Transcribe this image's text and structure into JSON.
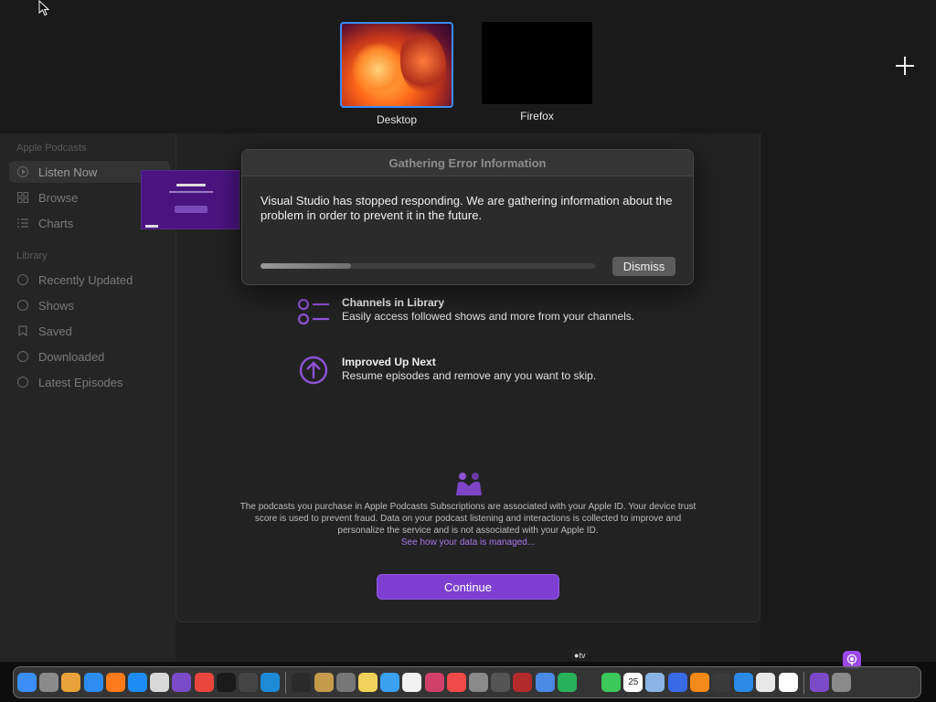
{
  "spaces": {
    "items": [
      {
        "label": "Desktop"
      },
      {
        "label": "Firefox"
      }
    ],
    "add_icon": "plus-icon"
  },
  "sidebar": {
    "section_apple": "Apple Podcasts",
    "section_library": "Library",
    "items": [
      {
        "label": "Listen Now",
        "icon": "play-circle-icon"
      },
      {
        "label": "Browse",
        "icon": "grid-icon"
      },
      {
        "label": "Charts",
        "icon": "list-icon"
      },
      {
        "label": "Recently Updated",
        "icon": "clock-icon"
      },
      {
        "label": "Shows",
        "icon": "podcast-icon"
      },
      {
        "label": "Saved",
        "icon": "bookmark-icon"
      },
      {
        "label": "Downloaded",
        "icon": "download-icon"
      },
      {
        "label": "Latest Episodes",
        "icon": "stack-icon"
      }
    ]
  },
  "features": [
    {
      "title": "Channels in Library",
      "desc": "Easily access followed shows and more from your channels.",
      "icon": "channels-icon"
    },
    {
      "title": "Improved Up Next",
      "desc": "Resume episodes and remove any you want to skip.",
      "icon": "up-arrow-circle-icon"
    }
  ],
  "privacy": {
    "text": "The podcasts you purchase in Apple Podcasts Subscriptions are associated with your Apple ID. Your device trust score is used to prevent fraud. Data on your podcast listening and interactions is collected to improve and personalize the service and is not associated with your Apple ID.",
    "link": "See how your data is managed..."
  },
  "continue_label": "Continue",
  "dialog": {
    "title": "Gathering Error Information",
    "message": "Visual Studio has stopped responding. We are gathering information about the problem in order to prevent it in the future.",
    "progress": 0.27,
    "dismiss_label": "Dismiss"
  },
  "dock": {
    "appletv_label": "tv",
    "calendar_day": "25",
    "apps": [
      {
        "name": "finder",
        "color": "#3b8ef5"
      },
      {
        "name": "system-settings",
        "color": "#8a8a8a"
      },
      {
        "name": "launchpad",
        "color": "#e9a23b"
      },
      {
        "name": "safari",
        "color": "#2d8cf0"
      },
      {
        "name": "firefox",
        "color": "#ff7a1a"
      },
      {
        "name": "app-store",
        "color": "#1f8bf5"
      },
      {
        "name": "textedit",
        "color": "#d8d8d8"
      },
      {
        "name": "visual-studio",
        "color": "#7a4ac8"
      },
      {
        "name": "chrome",
        "color": "#e8453c"
      },
      {
        "name": "terminal",
        "color": "#1b1b1b"
      },
      {
        "name": "paint",
        "color": "#444444"
      },
      {
        "name": "vscode",
        "color": "#1e8ad6"
      },
      {
        "name": "sep",
        "color": ""
      },
      {
        "name": "instruments",
        "color": "#2b2b2b"
      },
      {
        "name": "archive",
        "color": "#c59a4a"
      },
      {
        "name": "screenshot",
        "color": "#777777"
      },
      {
        "name": "notes",
        "color": "#f2d25a"
      },
      {
        "name": "icloud",
        "color": "#3aa0f0"
      },
      {
        "name": "reminders",
        "color": "#f2f2f2"
      },
      {
        "name": "shortcuts",
        "color": "#d0406a"
      },
      {
        "name": "news",
        "color": "#f04a4a"
      },
      {
        "name": "font-book",
        "color": "#8a8a8a"
      },
      {
        "name": "chess",
        "color": "#555555"
      },
      {
        "name": "dictionary",
        "color": "#b22a2a"
      },
      {
        "name": "grapher",
        "color": "#4a8ae6"
      },
      {
        "name": "find-my",
        "color": "#29b05a"
      },
      {
        "name": "voice-memos",
        "color": "#333333"
      },
      {
        "name": "messages",
        "color": "#3cc85a"
      },
      {
        "name": "calendar",
        "color": "#ffffff"
      },
      {
        "name": "preview",
        "color": "#8ab4e6"
      },
      {
        "name": "stickies",
        "color": "#3a6ae6"
      },
      {
        "name": "books",
        "color": "#f28a1a"
      },
      {
        "name": "calculator",
        "color": "#3a3a3a"
      },
      {
        "name": "keynote",
        "color": "#2a8ae6"
      },
      {
        "name": "clock",
        "color": "#e8e8e8"
      },
      {
        "name": "orl",
        "color": "#ffffff"
      },
      {
        "name": "sep",
        "color": ""
      },
      {
        "name": "podcasts-window",
        "color": "#7a4ac8"
      },
      {
        "name": "trash",
        "color": "#8a8a8a"
      }
    ]
  }
}
